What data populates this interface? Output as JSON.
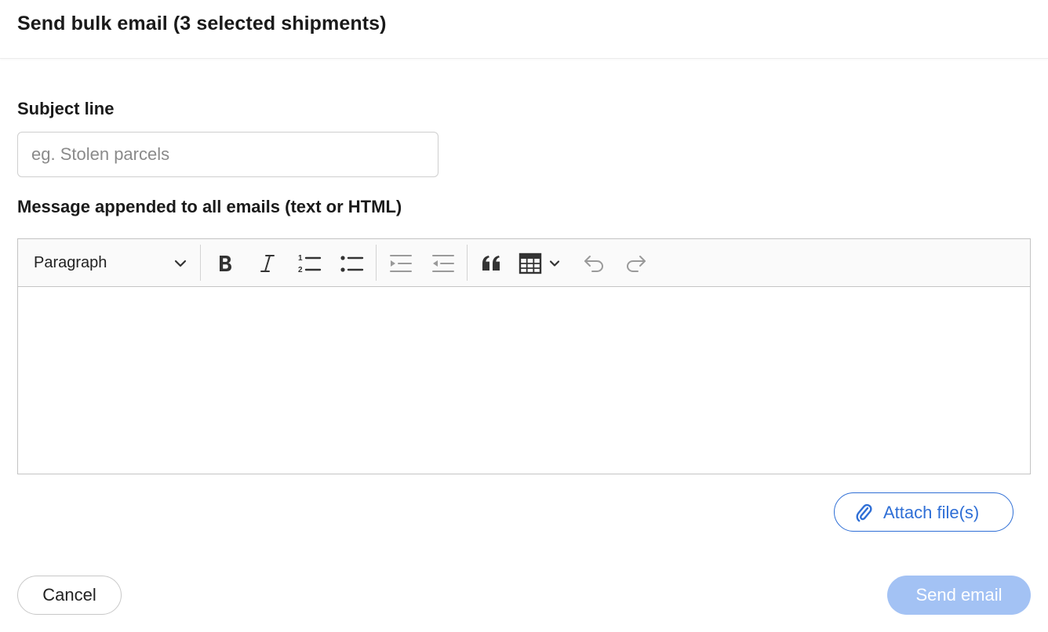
{
  "header": {
    "title": "Send bulk email (3 selected shipments)"
  },
  "form": {
    "subject_label": "Subject line",
    "subject_placeholder": "eg. Stolen parcels",
    "subject_value": "",
    "message_label": "Message appended to all emails (text or HTML)"
  },
  "toolbar": {
    "heading_select": "Paragraph",
    "buttons": [
      {
        "icon": "bold-icon"
      },
      {
        "icon": "italic-icon"
      },
      {
        "icon": "numbered-list-icon"
      },
      {
        "icon": "bulleted-list-icon"
      },
      {
        "icon": "increase-indent-icon",
        "disabled": true
      },
      {
        "icon": "decrease-indent-icon",
        "disabled": true
      },
      {
        "icon": "blockquote-icon"
      },
      {
        "icon": "table-icon"
      },
      {
        "icon": "undo-icon",
        "disabled": true
      },
      {
        "icon": "redo-icon",
        "disabled": true
      }
    ]
  },
  "editor": {
    "content": ""
  },
  "actions": {
    "attach_label": "Attach file(s)",
    "attach_icon": "paperclip-icon",
    "cancel_label": "Cancel",
    "send_label": "Send email"
  },
  "colors": {
    "accent": "#2f6fd6",
    "send_disabled_bg": "#a3c2f4",
    "toolbar_bg": "#fafafa",
    "border": "#c4c4c4"
  }
}
